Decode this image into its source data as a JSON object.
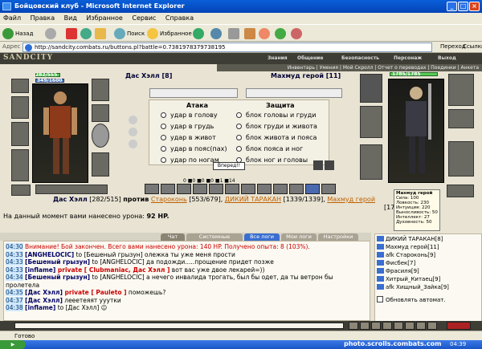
{
  "window": {
    "title": "Бойцовский клуб - Microsoft Internet Explorer"
  },
  "menu": [
    "Файл",
    "Правка",
    "Вид",
    "Избранное",
    "Сервис",
    "Справка"
  ],
  "toolbar": {
    "back": "Назад",
    "search": "Поиск",
    "favorites": "Избранное"
  },
  "address": {
    "label": "Адрес",
    "url": "http://sandcity.combats.ru/buttons.pl?battle=0.7381978379738195",
    "go": "Переход",
    "links": "Ссылки"
  },
  "game": {
    "logo": "SANDCITY",
    "nav": [
      "Знания",
      "Общение",
      "Безопасность",
      "Персонаж",
      "Выход"
    ],
    "subnav": "Инвентарь | Умения | Мой Скролл | Отчет о переводах | Поединки | Анкета"
  },
  "player": {
    "name": "Дас Хэлл",
    "level": "[8]",
    "hp_text": "282/555",
    "mp_text": "349/1600",
    "hp_fraction": 0.51
  },
  "enemy": {
    "name": "Махмуд герой",
    "level": "[11]",
    "hp_text": "1785/1785",
    "hp_fraction": 1.0
  },
  "attack": {
    "heading": "Атака",
    "options": [
      "удар в голову",
      "удар в грудь",
      "удар в живот",
      "удар в пояс(пах)",
      "удар по ногам"
    ]
  },
  "defense": {
    "heading": "Защита",
    "options": [
      "блок головы и груди",
      "блок груди и живота",
      "блок живота и пояса",
      "блок пояса и ног",
      "блок ног и головы"
    ]
  },
  "forward_button": "Вперед!!",
  "counters": "0 ■0 ■0 ■0 ■1 ■14",
  "battle": {
    "player": "Дас Хэлл",
    "player_hp": "[282/515]",
    "vs": "против",
    "opponents": [
      {
        "name": "Староконь",
        "hp": "[553/679]"
      },
      {
        "name": "ДИКИЙ ТАРАКАН",
        "hp": "[1339/1339]"
      },
      {
        "name": "Махмуд герой",
        "hp": "[1785/1785]"
      }
    ],
    "damage_label": "На данный момент вами нанесено урона:",
    "damage_value": "92 HP."
  },
  "tooltip": {
    "title": "Махмуд герой",
    "lines": [
      "Сила: 100",
      "Ловкость: 230",
      "Интуиция: 220",
      "Выносливость: 50",
      "Интеллект: 27",
      "Духовность: 50"
    ]
  },
  "tabs": [
    "Чат",
    "Системные сообщения",
    "Все логи",
    "Мои логи",
    "Настройки"
  ],
  "chat": [
    {
      "time": "04:30",
      "parts": [
        {
          "t": "Внимание!",
          "c": "sys"
        },
        {
          "t": " Бой закончен. Всего вами нанесено урона: 140 HP. Получено опыта: 8 (103%).",
          "c": "sys"
        }
      ]
    },
    {
      "time": "04:33",
      "parts": [
        {
          "t": "[ANGHELOCIC]",
          "c": "nick"
        },
        {
          "t": " to [Бешеный грызун] олежка ты уже меня прости",
          "c": ""
        }
      ]
    },
    {
      "time": "04:33",
      "parts": [
        {
          "t": "[Бешеный грызун]",
          "c": "nick"
        },
        {
          "t": " to [ANGHELOCIC] да подожди.....прощение придет позже",
          "c": ""
        }
      ]
    },
    {
      "time": "04:33",
      "parts": [
        {
          "t": "[inflame]",
          "c": "nick"
        },
        {
          "t": " private [ Clubmaniac, Дас Хэлл ]",
          "c": "prv"
        },
        {
          "t": " вот вас уже двое лекарей=))",
          "c": ""
        }
      ]
    },
    {
      "time": "04:34",
      "parts": [
        {
          "t": "[Бешеный грызун]",
          "c": "nick"
        },
        {
          "t": " to [ANGHELOCIC] а нечего инвалида трогать, был бы одет, да ты ветрон бы пролетела",
          "c": ""
        }
      ]
    },
    {
      "time": "04:35",
      "parts": [
        {
          "t": "[Дас Хэлл]",
          "c": "nick"
        },
        {
          "t": " private [ Pauleto ]",
          "c": "prv"
        },
        {
          "t": " поможешь?",
          "c": ""
        }
      ]
    },
    {
      "time": "04:37",
      "parts": [
        {
          "t": "[Дас Хэлл]",
          "c": "nick"
        },
        {
          "t": " лееетеяят ууутки",
          "c": ""
        }
      ]
    },
    {
      "time": "04:38",
      "parts": [
        {
          "t": "[inflame]",
          "c": "nick"
        },
        {
          "t": " to [Дас Хэлл] ☺",
          "c": ""
        }
      ]
    }
  ],
  "online": [
    "ДИКИЙ ТАРАКАН[8]",
    "Махмуд герой[11]",
    "afk Староконь[9]",
    "Фисбек[7]",
    "Фрасиля[9]",
    "Хитрый_Китаец[9]",
    "afk Хищный_Зайка[9]"
  ],
  "online_auto": "Обновлять автомат.",
  "status": "Готово",
  "clock": "04:39",
  "watermark": "photo.scrolls.combats.com"
}
